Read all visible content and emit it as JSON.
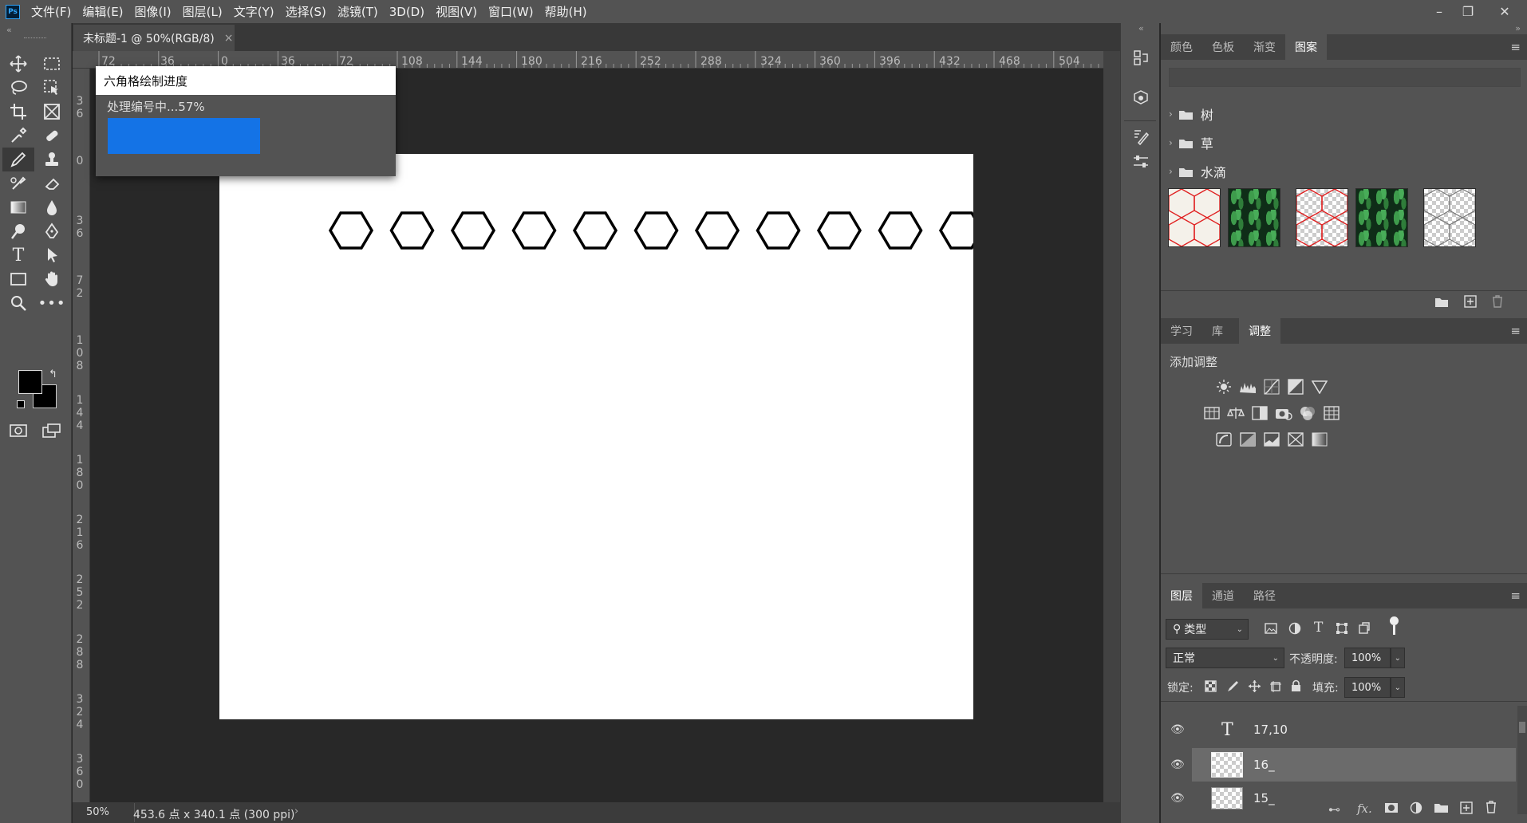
{
  "app": {
    "logo": "Ps"
  },
  "menu": [
    "文件(F)",
    "编辑(E)",
    "图像(I)",
    "图层(L)",
    "文字(Y)",
    "选择(S)",
    "滤镜(T)",
    "3D(D)",
    "视图(V)",
    "窗口(W)",
    "帮助(H)"
  ],
  "window_controls": {
    "minimize": "–",
    "restore": "❐",
    "close": "✕"
  },
  "document": {
    "tab_title": "未标题-1 @ 50%(RGB/8)",
    "tab_close": "×"
  },
  "ruler": {
    "h_labels": [
      "72",
      "36",
      "0",
      "36",
      "72",
      "108",
      "144",
      "180",
      "216",
      "252",
      "288",
      "324",
      "360",
      "396",
      "432",
      "468",
      "504"
    ],
    "v_labels": [
      "3\n6",
      "0",
      "3\n6",
      "7\n2",
      "1\n0\n8",
      "1\n4\n4",
      "1\n8\n0",
      "2\n1\n6",
      "2\n5\n2",
      "2\n8\n8",
      "3\n2\n4",
      "3\n6\n0"
    ]
  },
  "dialog": {
    "title": "六角格绘制进度",
    "status": "处理编号中...57%",
    "progress": 0.57
  },
  "status": {
    "zoom": "50%",
    "doc_info": "453.6 点 x 340.1 点 (300 ppi)",
    "arrow": "›"
  },
  "canvas": {
    "hexagon_count": 11
  },
  "panels": {
    "collapse": "»",
    "top_tabs": [
      "颜色",
      "色板",
      "渐变",
      "图案"
    ],
    "top_active": 3,
    "pattern_groups": [
      "树",
      "草",
      "水滴"
    ],
    "pattern_thumbs": [
      "red-hex-on-paper",
      "green-leaves",
      "red-hex-transparent",
      "green-leaves",
      "gray-hex-transparent"
    ],
    "mid_tabs": [
      "学习",
      "库",
      "调整"
    ],
    "mid_active": 2,
    "add_adjustment": "添加调整",
    "layers_tabs": [
      "图层",
      "通道",
      "路径"
    ],
    "layers_active": 0,
    "filter_type": "类型",
    "blend_mode": "正常",
    "opacity_label": "不透明度:",
    "opacity_value": "100%",
    "lock_label": "锁定:",
    "fill_label": "填充:",
    "fill_value": "100%",
    "layers": [
      {
        "name": "17,10",
        "type": "text",
        "selected": false
      },
      {
        "name": "16_",
        "type": "pixel",
        "selected": true
      },
      {
        "name": "15_",
        "type": "pixel",
        "selected": false
      }
    ]
  },
  "colors": {
    "accent": "#1473e6",
    "panel": "#535353",
    "dark": "#282828"
  }
}
